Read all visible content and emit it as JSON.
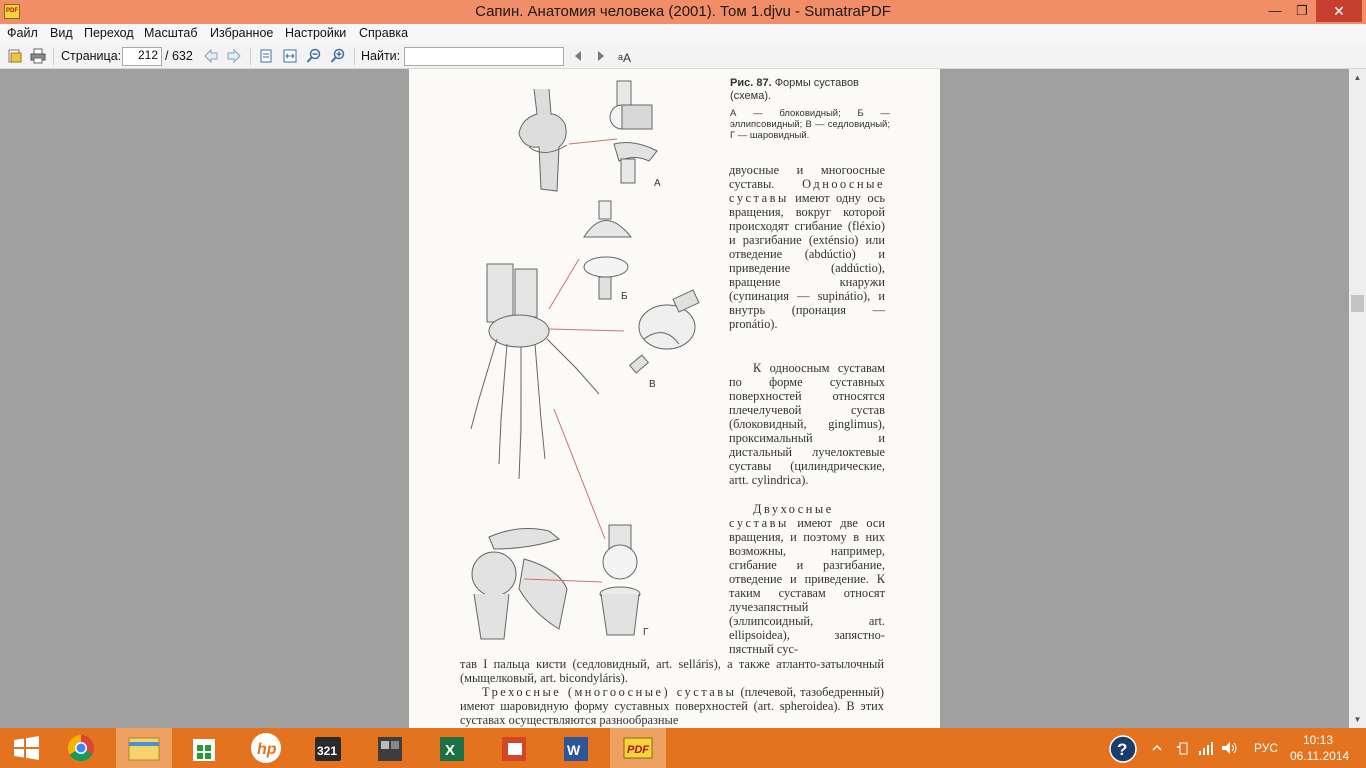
{
  "window": {
    "title": "Сапин. Анатомия человека (2001). Том 1.djvu - SumatraPDF",
    "app_icon_text": "PDF",
    "minimize": "—",
    "maximize": "❐",
    "close": "✕"
  },
  "menu": {
    "items": [
      {
        "label": "Файл"
      },
      {
        "label": "Вид"
      },
      {
        "label": "Переход"
      },
      {
        "label": "Масштаб"
      },
      {
        "label": "Избранное"
      },
      {
        "label": "Настройки"
      },
      {
        "label": "Справка"
      }
    ]
  },
  "toolbar": {
    "page_label": "Страница:",
    "page_value": "212",
    "page_total": "/ 632",
    "find_label": "Найти:",
    "find_value": ""
  },
  "document": {
    "figure_caption_bold": "Рис. 87.",
    "figure_caption": "Формы суставов (схема).",
    "figure_legend": "А — блоковидный; Б — эллипсовидный; В — седловидный; Г — шаровидный.",
    "figure_letters": [
      "А",
      "Б",
      "В",
      "Г"
    ],
    "para1_start": "двуосные и многоосные суставы.",
    "para1_spaced": "Одноосные суставы",
    "para1_rest": "имеют одну ось вращения, вокруг которой происходят сгибание (fléxio) и разгибание (exténsio) или отведение (abdúctio) и приведение (addúctio), вращение кнаружи (супинация — supinátio), и внутрь (пронация — pronátio).",
    "para2": "К одноосным суставам по форме суставных поверхностей относятся плечелучевой сустав (блоковидный, ginglimus), проксимальный и дистальный лучелоктевые суставы (цилиндрические, artt. cylindrica).",
    "para3_spaced": "Двухосные суставы",
    "para3_rest": "имеют две оси вращения, и поэтому в них возможны, например, сгибание и разгибание, отведение и приведение. К таким суставам относят лучезапястный (эллипсоидный, art. ellipsoidea), запястно-пястный сус-",
    "para3_full": "тав I пальца кисти (седловидный, art. selláris), а также атланто-затылочный (мыщелковый, art. bicondyláris).",
    "para4_spaced": "Трехосные (многоосные) суставы",
    "para4_rest": "(плечевой, тазобедренный) имеют шаровидную форму суставных поверхностей (art. spheroidea). В этих суставах осуществляются разнообразные"
  },
  "taskbar": {
    "apps": [
      {
        "name": "start"
      },
      {
        "name": "chrome"
      },
      {
        "name": "file-explorer"
      },
      {
        "name": "store"
      },
      {
        "name": "hp"
      },
      {
        "name": "media-player-321"
      },
      {
        "name": "camera-app"
      },
      {
        "name": "excel"
      },
      {
        "name": "powerpoint"
      },
      {
        "name": "word"
      },
      {
        "name": "sumatrapdf"
      }
    ],
    "lang": "РУС",
    "time": "10:13",
    "date": "06.11.2014"
  }
}
